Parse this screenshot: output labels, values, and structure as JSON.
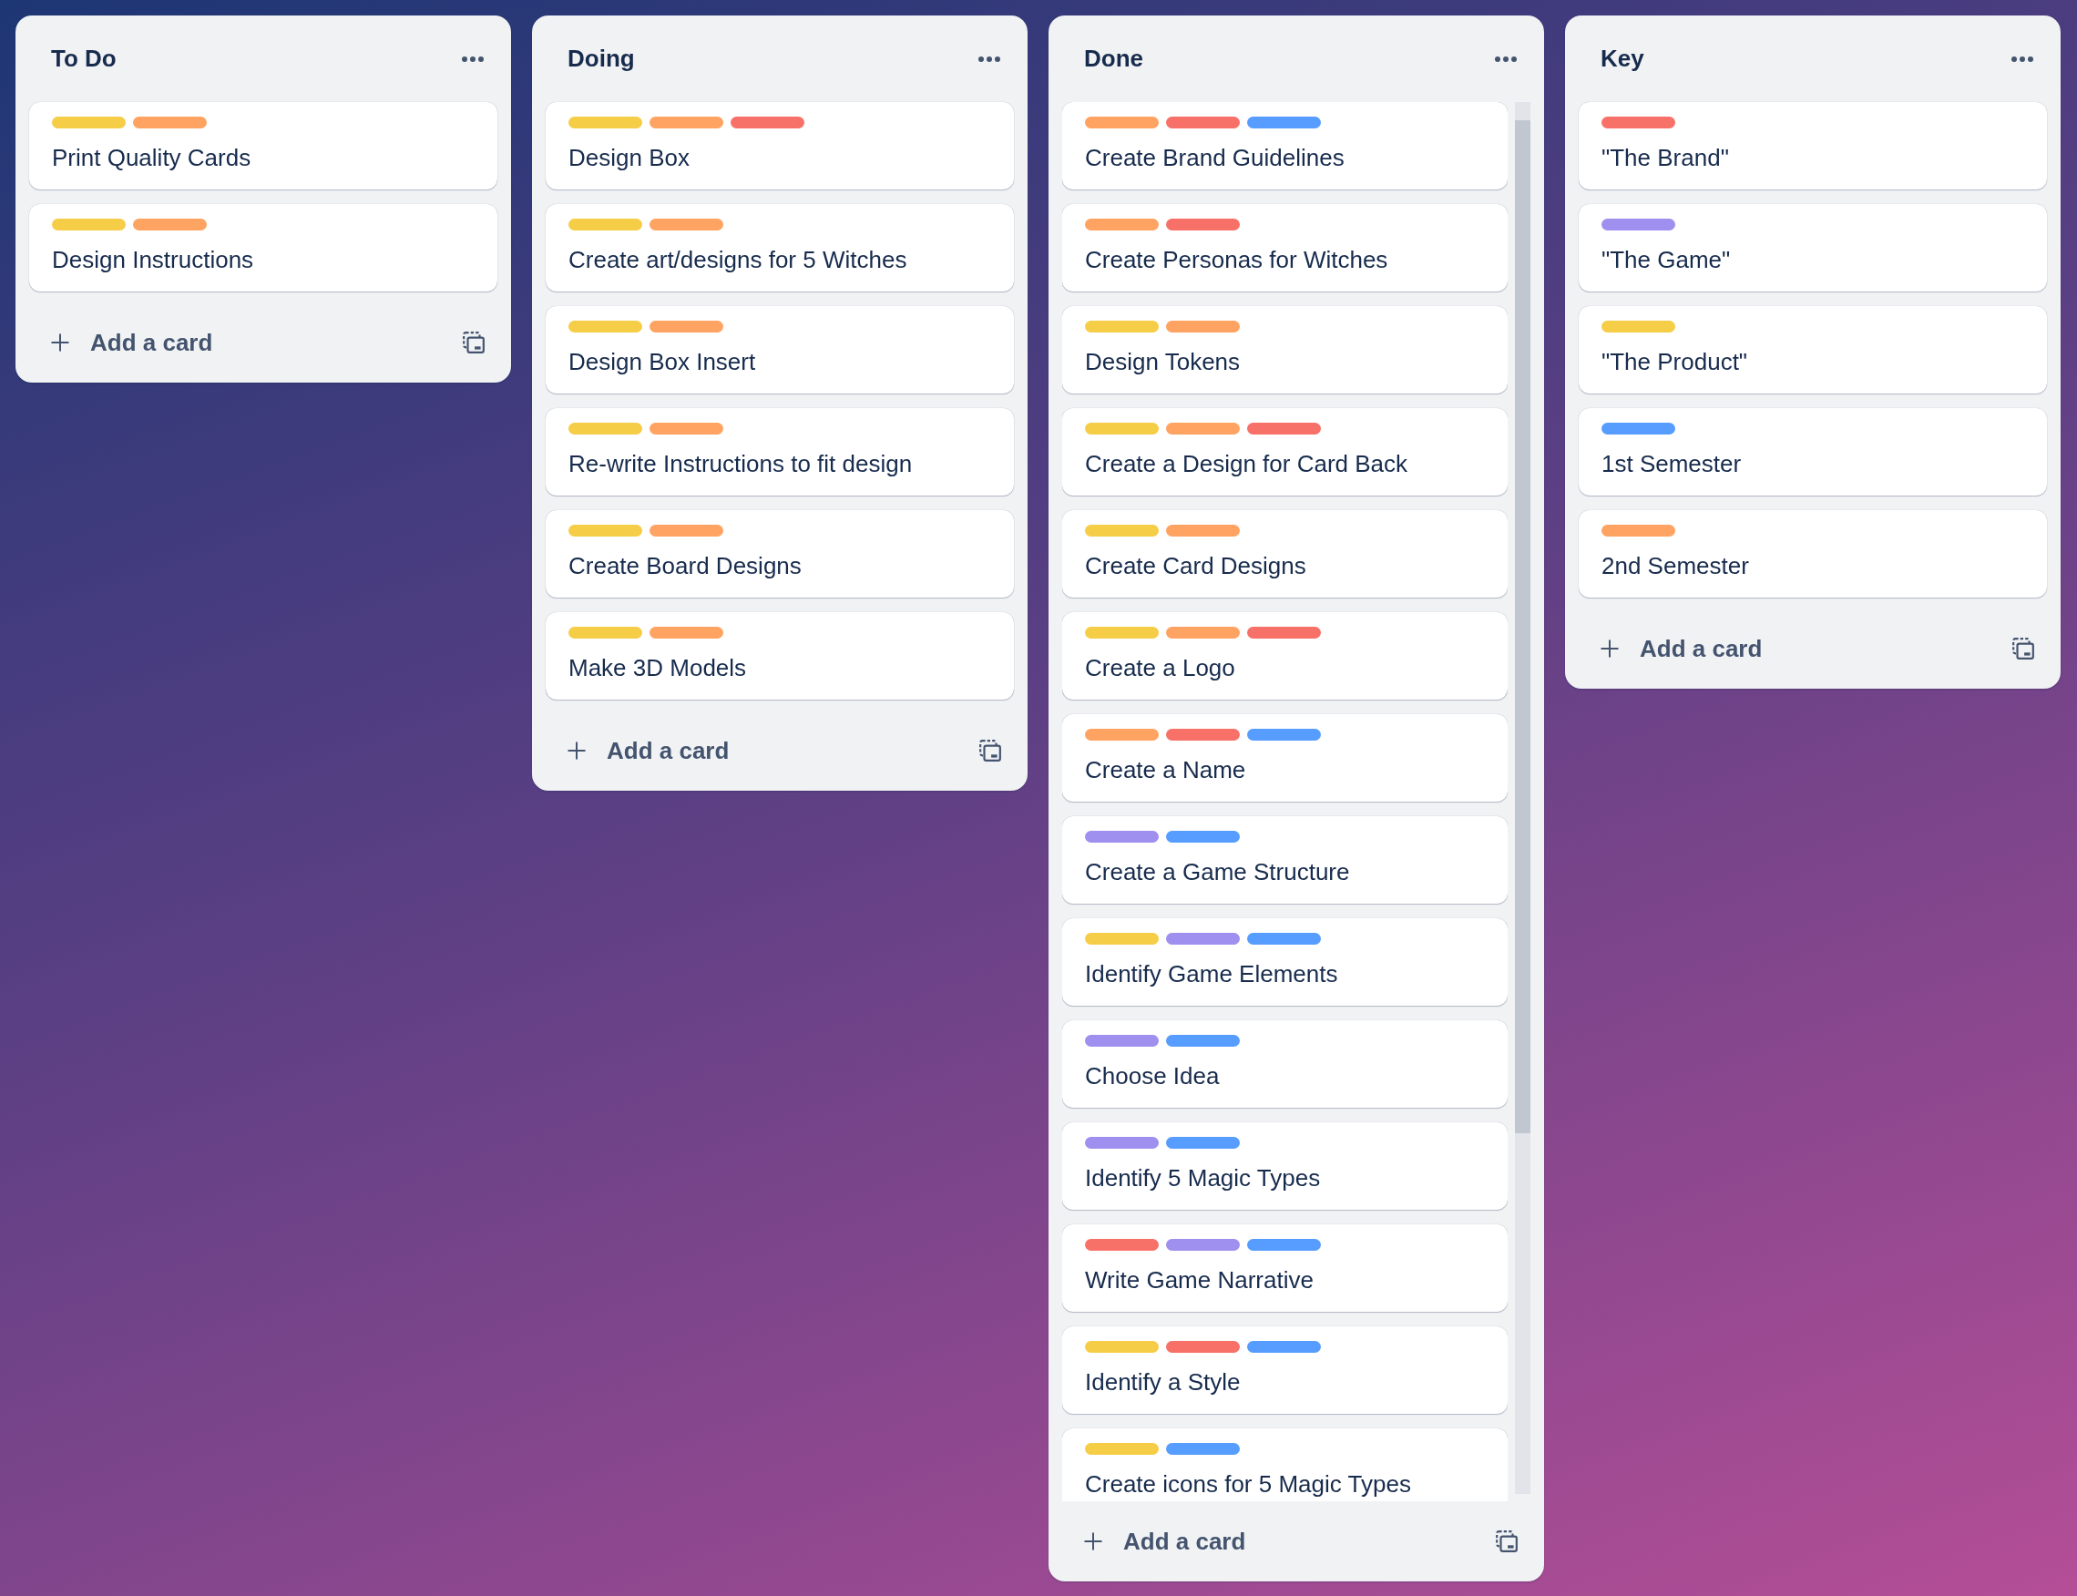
{
  "lists": [
    {
      "title": "To Do",
      "scrollable": false,
      "add_label": "Add a card",
      "cards": [
        {
          "labels": [
            {
              "color": "#f5cd47"
            },
            {
              "color": "#fea362"
            }
          ],
          "title": "Print Quality Cards"
        },
        {
          "labels": [
            {
              "color": "#f5cd47"
            },
            {
              "color": "#fea362"
            }
          ],
          "title": "Design Instructions"
        }
      ]
    },
    {
      "title": "Doing",
      "scrollable": false,
      "add_label": "Add a card",
      "cards": [
        {
          "labels": [
            {
              "color": "#f5cd47"
            },
            {
              "color": "#fea362"
            },
            {
              "color": "#f87168"
            }
          ],
          "title": "Design Box"
        },
        {
          "labels": [
            {
              "color": "#f5cd47"
            },
            {
              "color": "#fea362"
            }
          ],
          "title": "Create art/designs for 5 Witches"
        },
        {
          "labels": [
            {
              "color": "#f5cd47"
            },
            {
              "color": "#fea362"
            }
          ],
          "title": "Design Box Insert"
        },
        {
          "labels": [
            {
              "color": "#f5cd47"
            },
            {
              "color": "#fea362"
            }
          ],
          "title": "Re-write Instructions to fit design"
        },
        {
          "labels": [
            {
              "color": "#f5cd47"
            },
            {
              "color": "#fea362"
            }
          ],
          "title": "Create Board Designs"
        },
        {
          "labels": [
            {
              "color": "#f5cd47"
            },
            {
              "color": "#fea362"
            }
          ],
          "title": "Make 3D Models"
        }
      ]
    },
    {
      "title": "Done",
      "scrollable": true,
      "add_label": "Add a card",
      "cards": [
        {
          "labels": [
            {
              "color": "#fea362"
            },
            {
              "color": "#f87168"
            },
            {
              "color": "#579dff"
            }
          ],
          "title": "Create Brand Guidelines"
        },
        {
          "labels": [
            {
              "color": "#fea362"
            },
            {
              "color": "#f87168"
            }
          ],
          "title": "Create Personas for Witches"
        },
        {
          "labels": [
            {
              "color": "#f5cd47"
            },
            {
              "color": "#fea362"
            }
          ],
          "title": "Design Tokens"
        },
        {
          "labels": [
            {
              "color": "#f5cd47"
            },
            {
              "color": "#fea362"
            },
            {
              "color": "#f87168"
            }
          ],
          "title": "Create a Design for Card Back"
        },
        {
          "labels": [
            {
              "color": "#f5cd47"
            },
            {
              "color": "#fea362"
            }
          ],
          "title": "Create Card Designs"
        },
        {
          "labels": [
            {
              "color": "#f5cd47"
            },
            {
              "color": "#fea362"
            },
            {
              "color": "#f87168"
            }
          ],
          "title": "Create a Logo"
        },
        {
          "labels": [
            {
              "color": "#fea362"
            },
            {
              "color": "#f87168"
            },
            {
              "color": "#579dff"
            }
          ],
          "title": "Create a Name"
        },
        {
          "labels": [
            {
              "color": "#9f8fef"
            },
            {
              "color": "#579dff"
            }
          ],
          "title": "Create a Game Structure"
        },
        {
          "labels": [
            {
              "color": "#f5cd47"
            },
            {
              "color": "#9f8fef"
            },
            {
              "color": "#579dff"
            }
          ],
          "title": "Identify Game Elements"
        },
        {
          "labels": [
            {
              "color": "#9f8fef"
            },
            {
              "color": "#579dff"
            }
          ],
          "title": "Choose Idea"
        },
        {
          "labels": [
            {
              "color": "#9f8fef"
            },
            {
              "color": "#579dff"
            }
          ],
          "title": "Identify 5 Magic Types"
        },
        {
          "labels": [
            {
              "color": "#f87168"
            },
            {
              "color": "#9f8fef"
            },
            {
              "color": "#579dff"
            }
          ],
          "title": "Write Game Narrative"
        },
        {
          "labels": [
            {
              "color": "#f5cd47"
            },
            {
              "color": "#f87168"
            },
            {
              "color": "#579dff"
            }
          ],
          "title": "Identify a Style"
        },
        {
          "labels": [
            {
              "color": "#f5cd47"
            },
            {
              "color": "#579dff"
            }
          ],
          "title": "Create icons for 5 Magic Types"
        }
      ]
    },
    {
      "title": "Key",
      "scrollable": false,
      "add_label": "Add a card",
      "cards": [
        {
          "labels": [
            {
              "color": "#f87168"
            }
          ],
          "title": "\"The Brand\""
        },
        {
          "labels": [
            {
              "color": "#9f8fef"
            }
          ],
          "title": "\"The Game\""
        },
        {
          "labels": [
            {
              "color": "#f5cd47"
            }
          ],
          "title": "\"The Product\""
        },
        {
          "labels": [
            {
              "color": "#579dff"
            }
          ],
          "title": "1st Semester"
        },
        {
          "labels": [
            {
              "color": "#fea362"
            }
          ],
          "title": "2nd Semester"
        }
      ]
    }
  ]
}
